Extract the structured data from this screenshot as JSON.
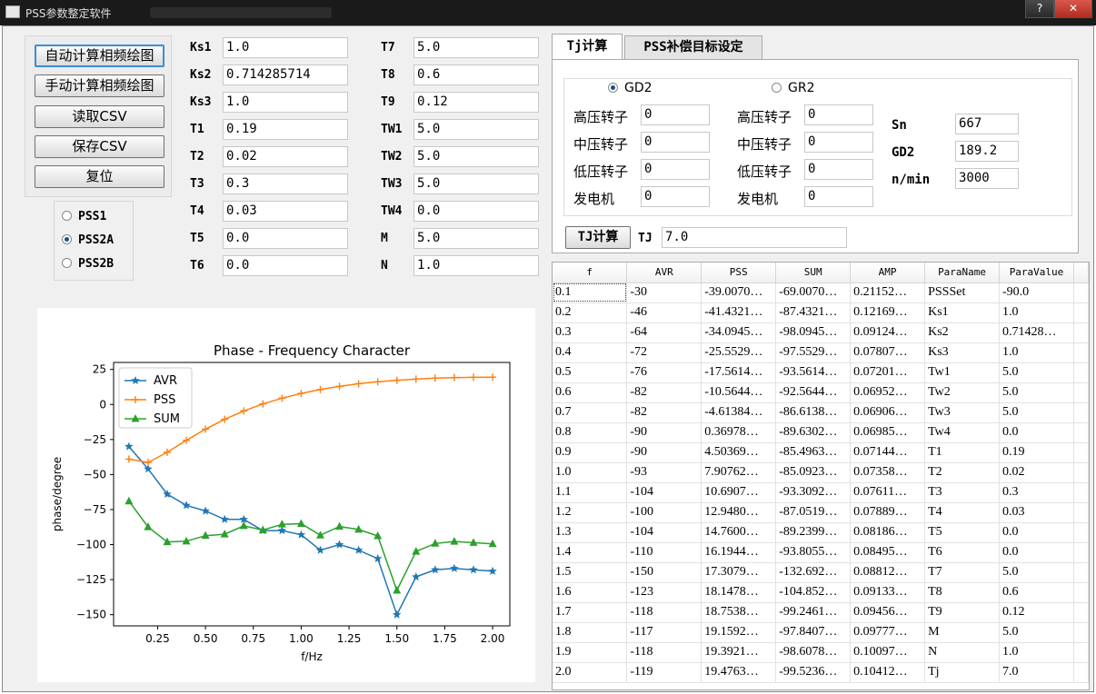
{
  "window": {
    "title": "PSS参数整定软件",
    "help": "?",
    "close": "✕"
  },
  "buttons": {
    "auto": "自动计算相频绘图",
    "manual": "手动计算相频绘图",
    "read": "读取CSV",
    "save": "保存CSV",
    "reset": "复位"
  },
  "model": {
    "options": [
      "PSS1",
      "PSS2A",
      "PSS2B"
    ],
    "selected": "PSS2A"
  },
  "params": [
    {
      "label": "Ks1",
      "value": "1.0"
    },
    {
      "label": "Ks2",
      "value": "0.714285714"
    },
    {
      "label": "Ks3",
      "value": "1.0"
    },
    {
      "label": "T1",
      "value": "0.19"
    },
    {
      "label": "T2",
      "value": "0.02"
    },
    {
      "label": "T3",
      "value": "0.3"
    },
    {
      "label": "T4",
      "value": "0.03"
    },
    {
      "label": "T5",
      "value": "0.0"
    },
    {
      "label": "T6",
      "value": "0.0"
    },
    {
      "label": "T7",
      "value": "5.0"
    },
    {
      "label": "T8",
      "value": "0.6"
    },
    {
      "label": "T9",
      "value": "0.12"
    },
    {
      "label": "TW1",
      "value": "5.0"
    },
    {
      "label": "TW2",
      "value": "5.0"
    },
    {
      "label": "TW3",
      "value": "5.0"
    },
    {
      "label": "TW4",
      "value": "0.0"
    },
    {
      "label": "M",
      "value": "5.0"
    },
    {
      "label": "N",
      "value": "1.0"
    }
  ],
  "tabs": {
    "tj": "Tj计算",
    "pss": "PSS补偿目标设定"
  },
  "tj": {
    "gd2_label": "GD2",
    "gr2_label": "GR2",
    "selected": "GD2",
    "rows_left": [
      {
        "label": "高压转子",
        "value": "0"
      },
      {
        "label": "中压转子",
        "value": "0"
      },
      {
        "label": "低压转子",
        "value": "0"
      },
      {
        "label": "发电机",
        "value": "0"
      }
    ],
    "rows_right": [
      {
        "label": "高压转子",
        "value": "0"
      },
      {
        "label": "中压转子",
        "value": "0"
      },
      {
        "label": "低压转子",
        "value": "0"
      },
      {
        "label": "发电机",
        "value": "0"
      }
    ],
    "sn_label": "Sn",
    "sn": "667",
    "gd2_val_label": "GD2",
    "gd2": "189.2",
    "nmin_label": "n/min",
    "nmin": "3000",
    "calc_button": "TJ计算",
    "tj_label": "TJ",
    "tj": "7.0"
  },
  "table": {
    "headers": [
      "f",
      "AVR",
      "PSS",
      "SUM",
      "AMP",
      "ParaName",
      "ParaValue"
    ],
    "rows": [
      [
        "0.1",
        "-30",
        "-39.0070…",
        "-69.0070…",
        "0.21152…",
        "PSSSet",
        "-90.0"
      ],
      [
        "0.2",
        "-46",
        "-41.4321…",
        "-87.4321…",
        "0.12169…",
        "Ks1",
        "1.0"
      ],
      [
        "0.3",
        "-64",
        "-34.0945…",
        "-98.0945…",
        "0.09124…",
        "Ks2",
        "0.71428…"
      ],
      [
        "0.4",
        "-72",
        "-25.5529…",
        "-97.5529…",
        "0.07807…",
        "Ks3",
        "1.0"
      ],
      [
        "0.5",
        "-76",
        "-17.5614…",
        "-93.5614…",
        "0.07201…",
        "Tw1",
        "5.0"
      ],
      [
        "0.6",
        "-82",
        "-10.5644…",
        "-92.5644…",
        "0.06952…",
        "Tw2",
        "5.0"
      ],
      [
        "0.7",
        "-82",
        "-4.61384…",
        "-86.6138…",
        "0.06906…",
        "Tw3",
        "5.0"
      ],
      [
        "0.8",
        "-90",
        "0.36978…",
        "-89.6302…",
        "0.06985…",
        "Tw4",
        "0.0"
      ],
      [
        "0.9",
        "-90",
        "4.50369…",
        "-85.4963…",
        "0.07144…",
        "T1",
        "0.19"
      ],
      [
        "1.0",
        "-93",
        "7.90762…",
        "-85.0923…",
        "0.07358…",
        "T2",
        "0.02"
      ],
      [
        "1.1",
        "-104",
        "10.6907…",
        "-93.3092…",
        "0.07611…",
        "T3",
        "0.3"
      ],
      [
        "1.2",
        "-100",
        "12.9480…",
        "-87.0519…",
        "0.07889…",
        "T4",
        "0.03"
      ],
      [
        "1.3",
        "-104",
        "14.7600…",
        "-89.2399…",
        "0.08186…",
        "T5",
        "0.0"
      ],
      [
        "1.4",
        "-110",
        "16.1944…",
        "-93.8055…",
        "0.08495…",
        "T6",
        "0.0"
      ],
      [
        "1.5",
        "-150",
        "17.3079…",
        "-132.692…",
        "0.08812…",
        "T7",
        "5.0"
      ],
      [
        "1.6",
        "-123",
        "18.1478…",
        "-104.852…",
        "0.09133…",
        "T8",
        "0.6"
      ],
      [
        "1.7",
        "-118",
        "18.7538…",
        "-99.2461…",
        "0.09456…",
        "T9",
        "0.12"
      ],
      [
        "1.8",
        "-117",
        "19.1592…",
        "-97.8407…",
        "0.09777…",
        "M",
        "5.0"
      ],
      [
        "1.9",
        "-118",
        "19.3921…",
        "-98.6078…",
        "0.10097…",
        "N",
        "1.0"
      ],
      [
        "2.0",
        "-119",
        "19.4763…",
        "-99.5236…",
        "0.10412…",
        "Tj",
        "7.0"
      ]
    ]
  },
  "chart_data": {
    "type": "line",
    "title": "Phase - Frequency Character",
    "xlabel": "f/Hz",
    "ylabel": "phase/degree",
    "xlim": [
      0.02,
      2.09
    ],
    "ylim": [
      -158,
      30
    ],
    "xticks": [
      "0.25",
      "0.50",
      "0.75",
      "1.00",
      "1.25",
      "1.50",
      "1.75",
      "2.00"
    ],
    "yticks": [
      "25",
      "0",
      "−25",
      "−50",
      "−75",
      "−100",
      "−125",
      "−150"
    ],
    "legend_position": "top-left",
    "x": [
      0.1,
      0.2,
      0.3,
      0.4,
      0.5,
      0.6,
      0.7,
      0.8,
      0.9,
      1.0,
      1.1,
      1.2,
      1.3,
      1.4,
      1.5,
      1.6,
      1.7,
      1.8,
      1.9,
      2.0
    ],
    "series": [
      {
        "name": "AVR",
        "color": "#1f77b4",
        "marker": "star",
        "values": [
          -30,
          -46,
          -64,
          -72,
          -76,
          -82,
          -82,
          -90,
          -90,
          -93,
          -104,
          -100,
          -104,
          -110,
          -150,
          -123,
          -118,
          -117,
          -118,
          -119
        ]
      },
      {
        "name": "PSS",
        "color": "#ff7f0e",
        "marker": "plus",
        "values": [
          -39.0,
          -41.4,
          -34.1,
          -25.6,
          -17.6,
          -10.6,
          -4.6,
          0.4,
          4.5,
          7.9,
          10.7,
          12.9,
          14.8,
          16.2,
          17.3,
          18.1,
          18.8,
          19.2,
          19.4,
          19.5
        ]
      },
      {
        "name": "SUM",
        "color": "#2ca02c",
        "marker": "triangle",
        "values": [
          -69.0,
          -87.4,
          -98.1,
          -97.6,
          -93.6,
          -92.6,
          -86.6,
          -89.6,
          -85.5,
          -85.1,
          -93.3,
          -87.1,
          -89.2,
          -93.8,
          -132.7,
          -104.9,
          -99.2,
          -97.8,
          -98.6,
          -99.5
        ]
      }
    ]
  }
}
